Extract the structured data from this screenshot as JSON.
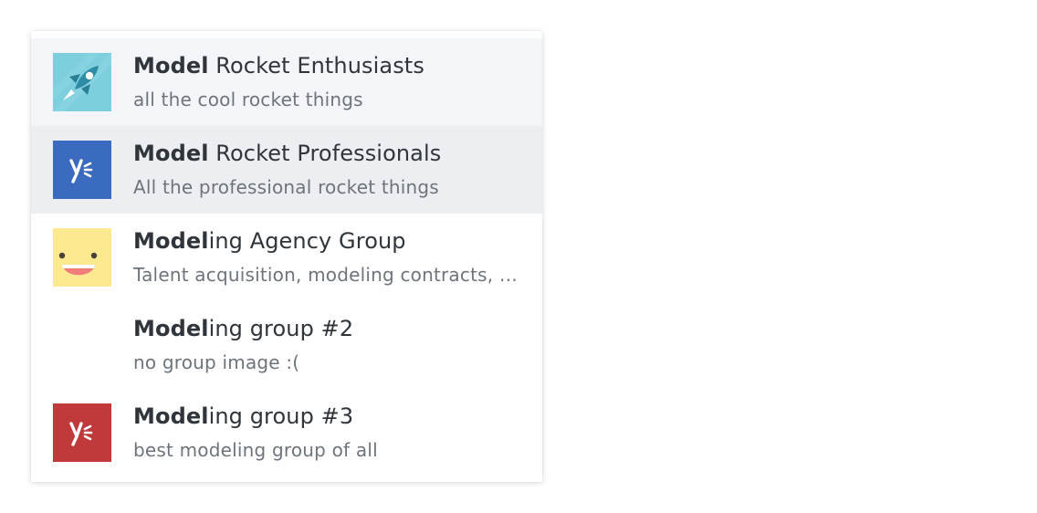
{
  "dropdown": {
    "items": [
      {
        "title_match": "Model",
        "title_rest": " Rocket Enthusiasts",
        "subtitle": "all the cool rocket things",
        "avatar_icon": "rocket-icon",
        "avatar_color": "#7dcfdd"
      },
      {
        "title_match": "Model",
        "title_rest": " Rocket Professionals",
        "subtitle": "All the professional rocket things",
        "avatar_icon": "yammer-logo-icon",
        "avatar_color": "#3a6bbe"
      },
      {
        "title_match": "Model",
        "title_rest": "ing Agency Group",
        "subtitle": "Talent acquisition, modeling contracts, and more",
        "avatar_icon": "smiley-face-icon",
        "avatar_color": "#fde98f"
      },
      {
        "title_match": "Model",
        "title_rest": "ing group #2",
        "subtitle": "no group image :(",
        "avatar_icon": "",
        "avatar_color": ""
      },
      {
        "title_match": "Model",
        "title_rest": "ing group #3",
        "subtitle": "best modeling group of all",
        "avatar_icon": "yammer-logo-icon",
        "avatar_color": "#c0393b"
      }
    ]
  }
}
